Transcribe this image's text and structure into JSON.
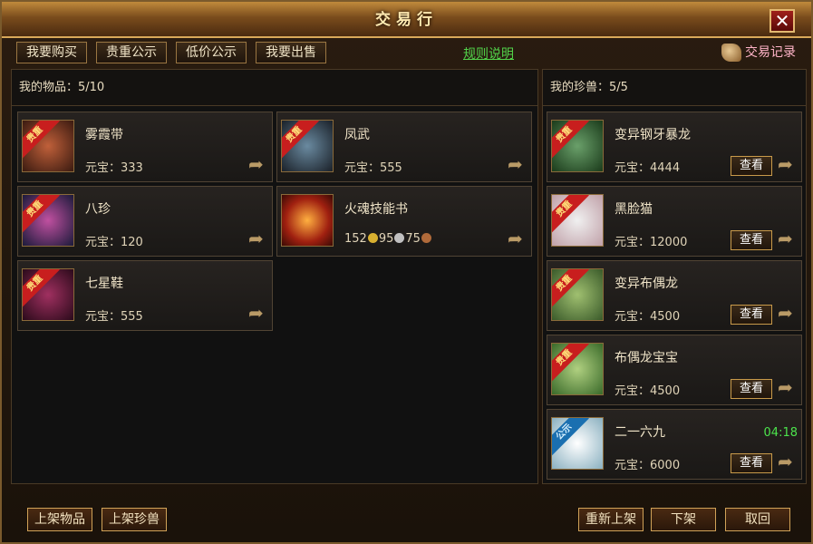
{
  "window": {
    "title": "交易行",
    "close": "✕"
  },
  "tabs": [
    "我要购买",
    "贵重公示",
    "低价公示",
    "我要出售"
  ],
  "rules_link": "规则说明",
  "trade_log": "交易记录",
  "items_panel": {
    "header": "我的物品：5/10"
  },
  "items": [
    {
      "name": "雾霞带",
      "price": "元宝：333",
      "badge": "贵重",
      "thumb_color": "#7a2a1a"
    },
    {
      "name": "凤武",
      "price": "元宝：555",
      "badge": "贵重",
      "thumb_color": "#3a4450"
    },
    {
      "name": "八珍",
      "price": "元宝：120",
      "badge": "贵重",
      "thumb_color": "#2a2a6a"
    },
    {
      "name": "火魂技能书",
      "price_parts": [
        "152",
        "95",
        "75"
      ],
      "badge": "",
      "thumb_color": "#b83010"
    },
    {
      "name": "七星鞋",
      "price": "元宝：555",
      "badge": "贵重",
      "thumb_color": "#5a1a3a"
    }
  ],
  "pets_panel": {
    "header": "我的珍兽：5/5"
  },
  "pets": [
    {
      "name": "变异钢牙暴龙",
      "price": "元宝：4444",
      "badge": "贵重",
      "view": "查看",
      "thumb_color": "#3a6a3a"
    },
    {
      "name": "黑脸猫",
      "price": "元宝：12000",
      "badge": "贵重",
      "view": "查看",
      "thumb_color": "#a06a7a"
    },
    {
      "name": "变异布偶龙",
      "price": "元宝：4500",
      "badge": "贵重",
      "view": "查看",
      "thumb_color": "#4a7a3a"
    },
    {
      "name": "布偶龙宝宝",
      "price": "元宝：4500",
      "badge": "贵重",
      "view": "查看",
      "thumb_color": "#5a8a4a"
    },
    {
      "name": "二一六九",
      "price": "元宝：6000",
      "badge": "公示",
      "view": "查看",
      "timer": "04:18",
      "thumb_color": "#6a9ab0"
    }
  ],
  "bottom_buttons": {
    "list_item": "上架物品",
    "list_pet": "上架珍兽",
    "relist": "重新上架",
    "delist": "下架",
    "cancel": "取回"
  }
}
